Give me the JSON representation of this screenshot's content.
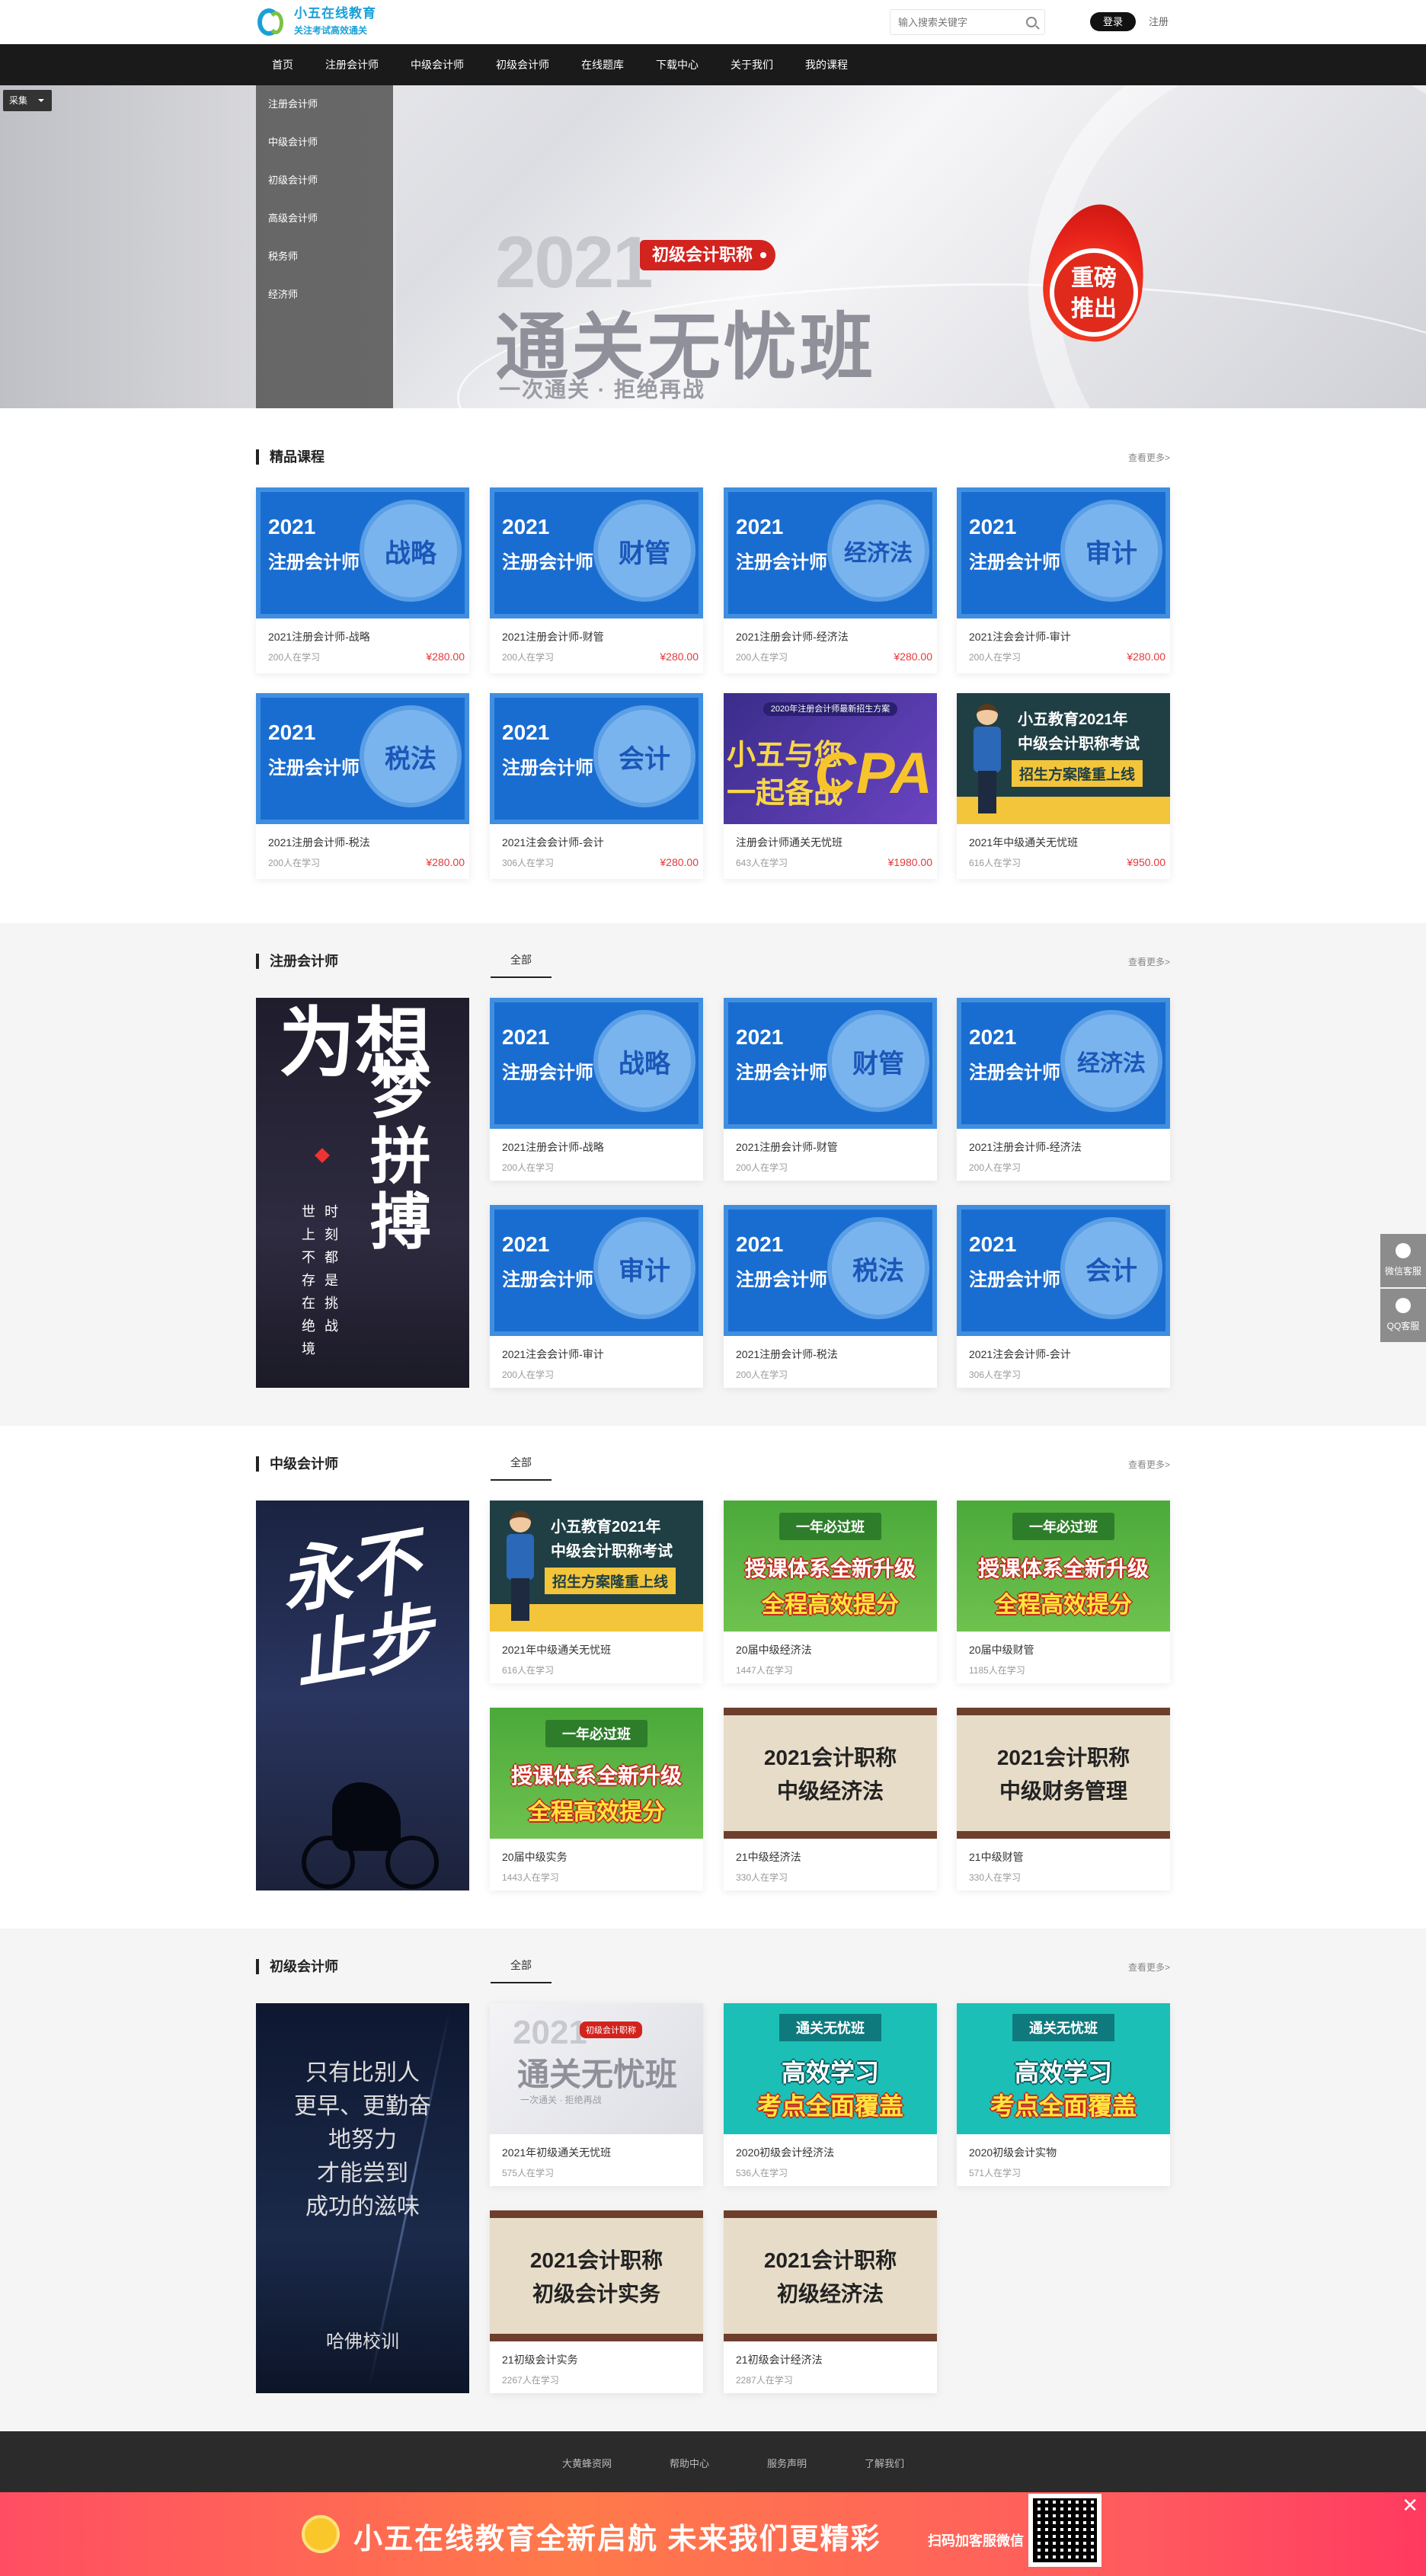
{
  "header": {
    "logo_title": "小五在线教育",
    "logo_subtitle": "关注考试高效通关",
    "search_placeholder": "输入搜索关键字",
    "login_label": "登录",
    "register_label": "注册"
  },
  "nav": {
    "items": [
      "首页",
      "注册会计师",
      "中级会计师",
      "初级会计师",
      "在线题库",
      "下载中心",
      "关于我们",
      "我的课程"
    ]
  },
  "banner": {
    "collect_label": "采集",
    "side_menu": [
      "注册会计师",
      "中级会计师",
      "初级会计师",
      "高级会计师",
      "税务师",
      "经济师"
    ],
    "year": "2021",
    "tag": "初级会计职称",
    "title": "通关无忧班",
    "subtitle": "一次通关 · 拒绝再战",
    "badge_line1": "重磅",
    "badge_line2": "推出"
  },
  "featured": {
    "title": "精品课程",
    "more": "查看更多>",
    "courses": [
      {
        "thumb_year": "2021",
        "thumb_type": "注册会计师",
        "thumb_subject": "战略",
        "name": "2021注册会计师-战略",
        "students": "200人在学习",
        "price": "¥280.00"
      },
      {
        "thumb_year": "2021",
        "thumb_type": "注册会计师",
        "thumb_subject": "财管",
        "name": "2021注册会计师-财管",
        "students": "200人在学习",
        "price": "¥280.00"
      },
      {
        "thumb_year": "2021",
        "thumb_type": "注册会计师",
        "thumb_subject": "经济法",
        "name": "2021注册会计师-经济法",
        "students": "200人在学习",
        "price": "¥280.00"
      },
      {
        "thumb_year": "2021",
        "thumb_type": "注册会计师",
        "thumb_subject": "审计",
        "name": "2021注会会计师-审计",
        "students": "200人在学习",
        "price": "¥280.00"
      },
      {
        "thumb_year": "2021",
        "thumb_type": "注册会计师",
        "thumb_subject": "税法",
        "name": "2021注册会计师-税法",
        "students": "200人在学习",
        "price": "¥280.00"
      },
      {
        "thumb_year": "2021",
        "thumb_type": "注册会计师",
        "thumb_subject": "会计",
        "name": "2021注会会计师-会计",
        "students": "306人在学习",
        "price": "¥280.00"
      },
      {
        "thumb_header": "2020年注册会计师最新招生方案",
        "thumb_line1": "小五与您",
        "thumb_line2": "一起备战",
        "thumb_cpa": "CPA",
        "name": "注册会计师通关无忧班",
        "students": "643人在学习",
        "price": "¥1980.00"
      },
      {
        "thumb_line1": "小五教育2021年",
        "thumb_line2": "中级会计职称考试",
        "thumb_line3": "招生方案隆重上线",
        "name": "2021年中级通关无忧班",
        "students": "616人在学习",
        "price": "¥950.00"
      }
    ]
  },
  "cpa": {
    "title": "注册会计师",
    "tab": "全部",
    "more": "查看更多>",
    "poster": {
      "big1": "为想",
      "big2": "梦拼搏",
      "col1": "世上不存在绝境",
      "col2": "时刻都是挑战"
    },
    "courses": [
      {
        "thumb_year": "2021",
        "thumb_type": "注册会计师",
        "thumb_subject": "战略",
        "name": "2021注册会计师-战略",
        "students": "200人在学习"
      },
      {
        "thumb_year": "2021",
        "thumb_type": "注册会计师",
        "thumb_subject": "财管",
        "name": "2021注册会计师-财管",
        "students": "200人在学习"
      },
      {
        "thumb_year": "2021",
        "thumb_type": "注册会计师",
        "thumb_subject": "经济法",
        "name": "2021注册会计师-经济法",
        "students": "200人在学习"
      },
      {
        "thumb_year": "2021",
        "thumb_type": "注册会计师",
        "thumb_subject": "审计",
        "name": "2021注会会计师-审计",
        "students": "200人在学习"
      },
      {
        "thumb_year": "2021",
        "thumb_type": "注册会计师",
        "thumb_subject": "税法",
        "name": "2021注册会计师-税法",
        "students": "200人在学习"
      },
      {
        "thumb_year": "2021",
        "thumb_type": "注册会计师",
        "thumb_subject": "会计",
        "name": "2021注会会计师-会计",
        "students": "306人在学习"
      }
    ]
  },
  "intermediate": {
    "title": "中级会计师",
    "tab": "全部",
    "more": "查看更多>",
    "poster": {
      "text": "永不止步"
    },
    "courses": [
      {
        "thumb_line1": "小五教育2021年",
        "thumb_line2": "中级会计职称考试",
        "thumb_line3": "招生方案隆重上线",
        "name": "2021年中级通关无忧班",
        "students": "616人在学习"
      },
      {
        "thumb_ribbon": "一年必过班",
        "thumb_line1": "授课体系全新升级",
        "thumb_line2": "全程高效提分",
        "name": "20届中级经济法",
        "students": "1447人在学习"
      },
      {
        "thumb_ribbon": "一年必过班",
        "thumb_line1": "授课体系全新升级",
        "thumb_line2": "全程高效提分",
        "name": "20届中级财管",
        "students": "1185人在学习"
      },
      {
        "thumb_ribbon": "一年必过班",
        "thumb_line1": "授课体系全新升级",
        "thumb_line2": "全程高效提分",
        "name": "20届中级实务",
        "students": "1443人在学习"
      },
      {
        "thumb_line1": "2021会计职称",
        "thumb_line2": "中级经济法",
        "name": "21中级经济法",
        "students": "330人在学习"
      },
      {
        "thumb_line1": "2021会计职称",
        "thumb_line2": "中级财务管理",
        "name": "21中级财管",
        "students": "330人在学习"
      }
    ]
  },
  "junior": {
    "title": "初级会计师",
    "tab": "全部",
    "more": "查看更多>",
    "poster": {
      "lines": [
        "只有比别人",
        "更早、更勤奋",
        "地努力",
        "才能尝到",
        "成功的滋味"
      ],
      "signature": "哈佛校训"
    },
    "courses": [
      {
        "thumb_year": "2021",
        "thumb_tag": "初级会计职称",
        "thumb_title": "通关无忧班",
        "thumb_sub": "一次通关 · 拒绝再战",
        "name": "2021年初级通关无忧班",
        "students": "575人在学习"
      },
      {
        "thumb_ribbon": "通关无忧班",
        "thumb_line1": "高效学习",
        "thumb_line2": "考点全面覆盖",
        "name": "2020初级会计经济法",
        "students": "536人在学习"
      },
      {
        "thumb_ribbon": "通关无忧班",
        "thumb_line1": "高效学习",
        "thumb_line2": "考点全面覆盖",
        "name": "2020初级会计实物",
        "students": "571人在学习"
      },
      {
        "thumb_line1": "2021会计职称",
        "thumb_line2": "初级会计实务",
        "name": "21初级会计实务",
        "students": "2267人在学习"
      },
      {
        "thumb_line1": "2021会计职称",
        "thumb_line2": "初级经济法",
        "name": "21初级会计经济法",
        "students": "2287人在学习"
      }
    ]
  },
  "footer": {
    "links": [
      "大黄蜂资网",
      "帮助中心",
      "服务声明",
      "了解我们"
    ]
  },
  "promo_bar": {
    "text": "小五在线教育全新启航 未来我们更精彩",
    "scan_text": "扫码加客服微信",
    "close": "✕"
  },
  "float_service": {
    "wechat": "微信客服",
    "qq": "QQ客服"
  },
  "colors": {
    "nav_bg": "#1a1a1a",
    "price_red": "#e4393c",
    "course_blue": "#1a6dd0",
    "logo_blue": "#1aa0d8"
  }
}
